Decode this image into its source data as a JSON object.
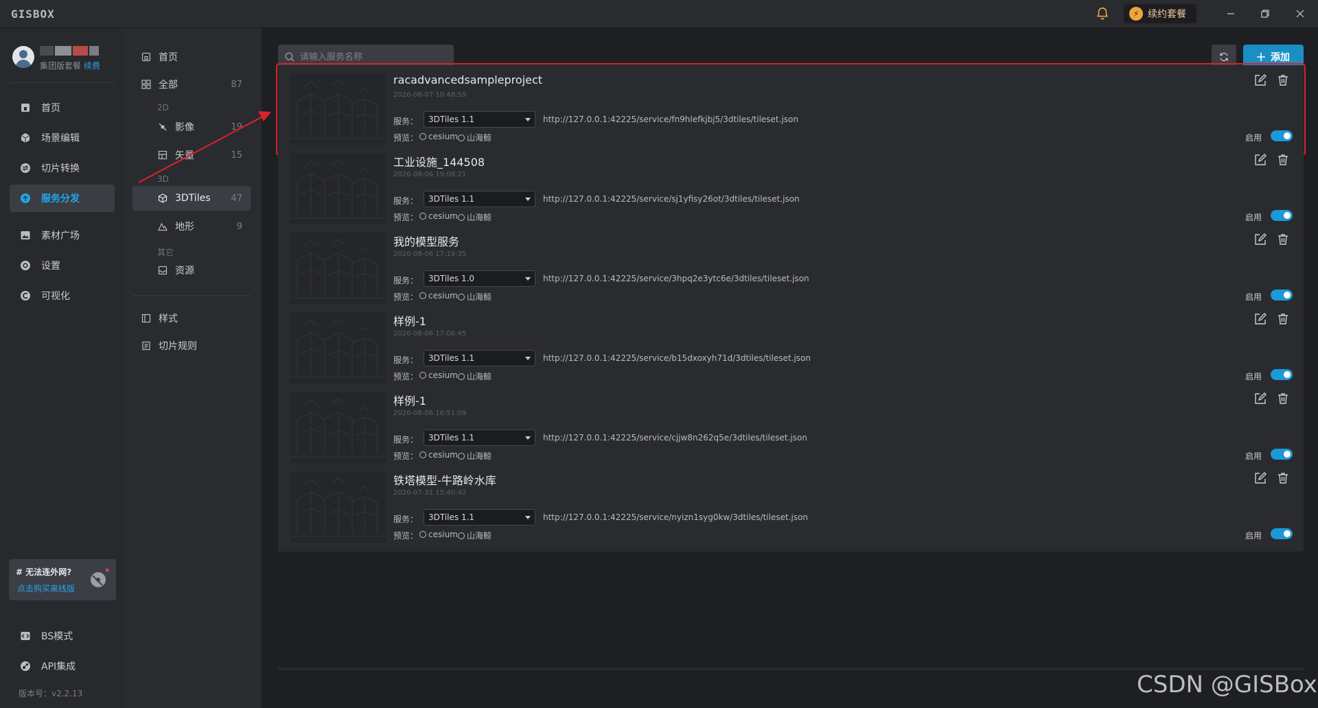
{
  "app": {
    "logo": "GISBOX"
  },
  "titlebar": {
    "renew_label": "续约套餐"
  },
  "user": {
    "plan": "集团版套餐",
    "renew_link": "续费"
  },
  "sidebar": {
    "items": [
      {
        "label": "首页",
        "icon": "home-icon"
      },
      {
        "label": "场景编辑",
        "icon": "cube-icon"
      },
      {
        "label": "切片转换",
        "icon": "convert-icon"
      },
      {
        "label": "服务分发",
        "icon": "upload-cloud-icon",
        "active": true
      },
      {
        "label": "素材广场",
        "icon": "image-icon"
      },
      {
        "label": "设置",
        "icon": "gear-icon"
      },
      {
        "label": "可视化",
        "icon": "visual-icon"
      }
    ],
    "offline": {
      "title": "# 无法连外网?",
      "link": "点击购买离线版"
    },
    "bottom_items": [
      {
        "label": "BS模式",
        "icon": "code-icon"
      },
      {
        "label": "API集成",
        "icon": "api-icon"
      }
    ],
    "version": "版本号：v2.2.13"
  },
  "subnav": {
    "home": "首页",
    "all": {
      "label": "全部",
      "count": "87"
    },
    "group_2d": "2D",
    "imagery": {
      "label": "影像",
      "count": "19"
    },
    "vector": {
      "label": "矢量",
      "count": "15"
    },
    "group_3d": "3D",
    "tiles3d": {
      "label": "3DTiles",
      "count": "47"
    },
    "terrain": {
      "label": "地形",
      "count": "9"
    },
    "group_other": "其它",
    "resource": {
      "label": "资源"
    },
    "style": "样式",
    "rules": "切片规则"
  },
  "toolbar": {
    "search_placeholder": "请输入服务名称",
    "add_label": "添加"
  },
  "labels": {
    "service": "服务：",
    "preview": "预览：",
    "cesium": "cesium",
    "shanhai": "山海鲸",
    "enable": "启用"
  },
  "services": [
    {
      "title": "racadvancedsampleproject",
      "date": "2026-08-07 10:48:59",
      "version": "3DTiles 1.1",
      "url": "http://127.0.0.1:42225/service/fn9hlefkjbj5/3dtiles/tileset.json",
      "enabled": true
    },
    {
      "title": "工业设施_144508",
      "date": "2026-08-06 19:08:21",
      "version": "3DTiles 1.1",
      "url": "http://127.0.0.1:42225/service/sj1yfisy26ot/3dtiles/tileset.json",
      "enabled": true
    },
    {
      "title": "我的模型服务",
      "date": "2026-08-06 17:19:35",
      "version": "3DTiles 1.0",
      "url": "http://127.0.0.1:42225/service/3hpq2e3ytc6e/3dtiles/tileset.json",
      "enabled": true
    },
    {
      "title": "样例-1",
      "date": "2026-08-06 17:06:45",
      "version": "3DTiles 1.1",
      "url": "http://127.0.0.1:42225/service/b15dxoxyh71d/3dtiles/tileset.json",
      "enabled": true
    },
    {
      "title": "样例-1",
      "date": "2026-08-06 16:51:09",
      "version": "3DTiles 1.1",
      "url": "http://127.0.0.1:42225/service/cjjw8n262q5e/3dtiles/tileset.json",
      "enabled": true
    },
    {
      "title": "铁塔模型-牛路岭水库",
      "date": "2026-07-31 15:40:42",
      "version": "3DTiles 1.1",
      "url": "http://127.0.0.1:42225/service/nyizn1syg0kw/3dtiles/tileset.json",
      "enabled": true
    }
  ],
  "watermark": "CSDN @GISBox",
  "colors": {
    "accent": "#1a8fc4",
    "highlight": "#d9232b",
    "renew": "#f2a33a"
  }
}
